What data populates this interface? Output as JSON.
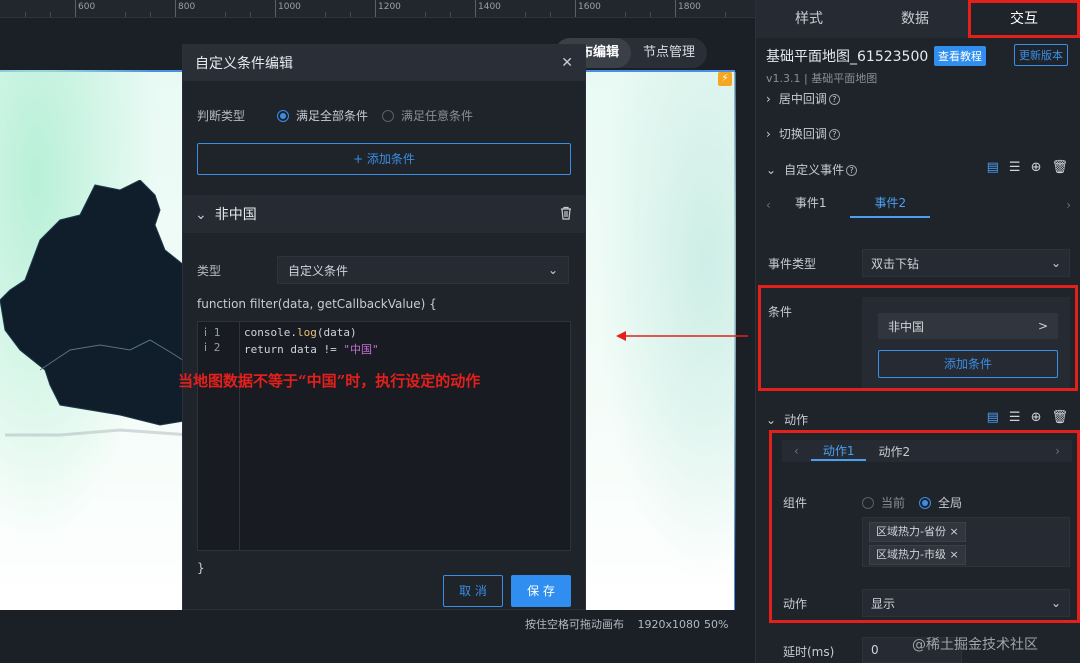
{
  "ruler": {
    "labels": [
      "600",
      "800",
      "1000",
      "1200",
      "1400",
      "1600",
      "1800"
    ]
  },
  "view_tabs": [
    {
      "label": "画布编辑",
      "active": true
    },
    {
      "label": "节点管理",
      "active": false
    }
  ],
  "status_bar": {
    "hint": "按住空格可拖动画布",
    "size": "1920x1080",
    "zoom": "50%"
  },
  "annotation": {
    "text": "当地图数据不等于“中国”时，执行设定的动作",
    "color": "#e3201c"
  },
  "modal": {
    "title": "自定义条件编辑",
    "close_icon": "close-icon",
    "judge_label": "判断类型",
    "judge_options": [
      {
        "label": "满足全部条件",
        "checked": true
      },
      {
        "label": "满足任意条件",
        "checked": false
      }
    ],
    "add_condition_label": "+ 添加条件",
    "section_title": "非中国",
    "delete_icon": "trash-icon",
    "type_label": "类型",
    "type_value": "自定义条件",
    "function_signature": "function filter(data, getCallbackValue) {",
    "code_lines": [
      {
        "num": "1",
        "text": "console.log(data)"
      },
      {
        "num": "2",
        "text": "return data != \"中国\""
      }
    ],
    "closing_brace": "}",
    "cancel_label": "取 消",
    "save_label": "保 存"
  },
  "panel": {
    "tabs": [
      {
        "label": "样式",
        "active": false
      },
      {
        "label": "数据",
        "active": false
      },
      {
        "label": "交互",
        "active": true
      }
    ],
    "component_title": "基础平面地图_61523500",
    "tutorial_label": "查看教程",
    "update_label": "更新版本",
    "version": "v1.3.1 | 基础平面地图",
    "sections": {
      "center_callback": "居中回调",
      "switch_callback": "切换回调",
      "custom_events": "自定义事件",
      "actions": "动作"
    },
    "event_tabs": [
      {
        "label": "事件1",
        "active": false
      },
      {
        "label": "事件2",
        "active": true
      }
    ],
    "event_type_label": "事件类型",
    "event_type_value": "双击下钻",
    "condition_label": "条件",
    "condition_item": "非中国",
    "condition_add": "添加条件",
    "action_tabs": [
      {
        "label": "动作1",
        "active": true
      },
      {
        "label": "动作2",
        "active": false
      }
    ],
    "component_label": "组件",
    "component_options": [
      {
        "label": "当前",
        "checked": false
      },
      {
        "label": "全局",
        "checked": true
      }
    ],
    "component_tags": [
      "区域热力-省份",
      "区域热力-市级"
    ],
    "action_label": "动作",
    "action_value": "显示",
    "delay_label": "延时(ms)",
    "delay_value": "0"
  },
  "watermark": "@稀土掘金技术社区",
  "colors": {
    "accent": "#2f8ef0",
    "highlight": "#e3201c",
    "panel_bg": "#1f232a"
  }
}
